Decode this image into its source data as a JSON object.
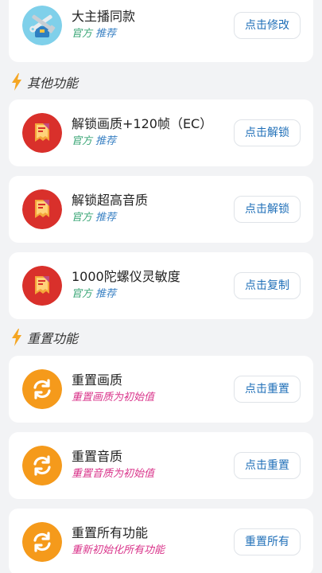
{
  "top_card": {
    "title": "大主播同款",
    "official": "官方",
    "recommend": "推荐",
    "button": "点击修改",
    "icon": "tools-icon"
  },
  "section_other": {
    "label": "其他功能",
    "icon": "lightning-icon"
  },
  "other_items": [
    {
      "title": "解锁画质+120帧（EC）",
      "official": "官方",
      "recommend": "推荐",
      "button": "点击解锁",
      "icon": "ticket-icon"
    },
    {
      "title": "解锁超高音质",
      "official": "官方",
      "recommend": "推荐",
      "button": "点击解锁",
      "icon": "ticket-icon"
    },
    {
      "title": "1000陀螺仪灵敏度",
      "official": "官方",
      "recommend": "推荐",
      "button": "点击复制",
      "icon": "ticket-icon"
    }
  ],
  "section_reset": {
    "label": "重置功能",
    "icon": "lightning-icon"
  },
  "reset_items": [
    {
      "title": "重置画质",
      "subtitle": "重置画质为初始值",
      "button": "点击重置",
      "icon": "refresh-icon"
    },
    {
      "title": "重置音质",
      "subtitle": "重置音质为初始值",
      "button": "点击重置",
      "icon": "refresh-icon"
    },
    {
      "title": "重置所有功能",
      "subtitle": "重新初始化所有功能",
      "button": "重置所有",
      "icon": "refresh-icon"
    }
  ],
  "colors": {
    "official": "#3aa676",
    "recommend": "#3b82c4",
    "reset_subtitle": "#d9338a",
    "button_text": "#1f6fb8",
    "ticket_bg": "#d9302b",
    "refresh_bg": "#f59a1b",
    "bolt": "#f5a623"
  }
}
